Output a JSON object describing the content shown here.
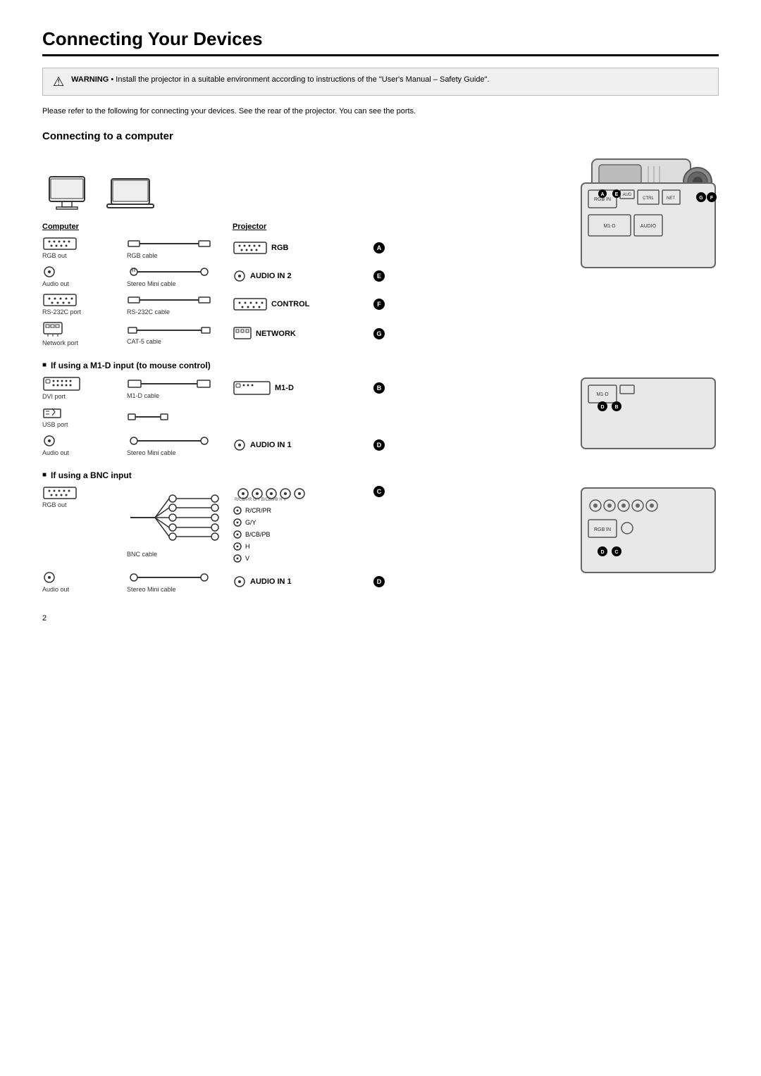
{
  "title": "Connecting Your Devices",
  "warning": {
    "label": "WARNING",
    "text": "Install the projector in a suitable environment according to instructions of the \"User's Manual – Safety Guide\"."
  },
  "intro": "Please refer to the following for connecting your devices. See the rear of the projector. You can see the ports.",
  "section1": {
    "heading": "Connecting to a computer",
    "headers": {
      "computer": "Computer",
      "projector": "Projector"
    },
    "rows": [
      {
        "comp_port": "RGB out",
        "cable": "RGB cable",
        "proj_port": "RGB",
        "badge": "A"
      },
      {
        "comp_port": "Audio out",
        "cable": "Stereo Mini cable",
        "proj_port": "AUDIO IN 2",
        "badge": "E"
      },
      {
        "comp_port": "RS-232C port",
        "cable": "RS-232C cable",
        "proj_port": "CONTROL",
        "badge": "F"
      },
      {
        "comp_port": "Network port",
        "cable": "CAT-5 cable",
        "proj_port": "NETWORK",
        "badge": "G"
      }
    ]
  },
  "section2": {
    "heading": "If using a M1-D input (to mouse control)",
    "rows": [
      {
        "comp_port": "DVI port",
        "cable": "M1-D cable",
        "proj_port": "M1-D",
        "badge": "B"
      },
      {
        "comp_port": "USB port",
        "cable": "",
        "proj_port": "",
        "badge": ""
      },
      {
        "comp_port": "Audio out",
        "cable": "Stereo Mini cable",
        "proj_port": "AUDIO IN 1",
        "badge": "D"
      }
    ]
  },
  "section3": {
    "heading": "If using a BNC input",
    "rows": [
      {
        "comp_port": "RGB out",
        "cable": "BNC cable",
        "proj_port_list": [
          "R/CR/PR",
          "G/Y",
          "B/CB/PB",
          "H",
          "V"
        ],
        "badge": "C"
      },
      {
        "comp_port": "Audio out",
        "cable": "Stereo Mini cable",
        "proj_port": "AUDIO IN 1",
        "badge": "D"
      }
    ]
  },
  "page_number": "2",
  "badge_labels": {
    "A": "A",
    "B": "B",
    "C": "C",
    "D": "D",
    "E": "E",
    "F": "F",
    "G": "G"
  }
}
